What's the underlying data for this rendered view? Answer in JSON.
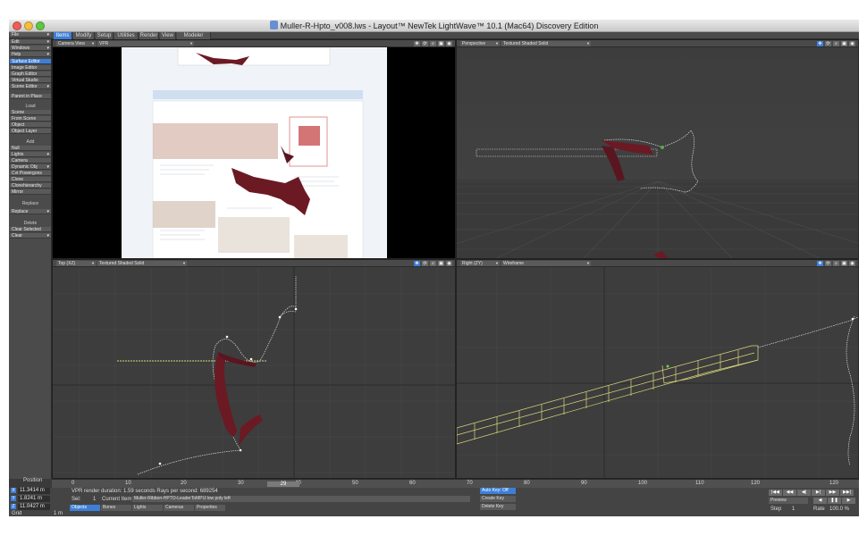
{
  "window": {
    "title": "Muller-R-Hpto_v008.lws - Layout™ NewTek LightWave™ 10.1 (Mac64) Discovery Edition",
    "colors": {
      "accent": "#3d7fd8",
      "close": "#ec5f58",
      "minimize": "#f5bd3a",
      "zoom": "#5fc73f",
      "ribbon": "#6b1a24",
      "spline": "#dddddd",
      "wire": "#d9d77a"
    }
  },
  "top_tabs": [
    "Items",
    "Modify",
    "Setup",
    "Utilities",
    "Render",
    "View",
    "Modeler Tools"
  ],
  "sidebar": {
    "menus": [
      "File",
      "Edit",
      "Windows",
      "Help"
    ],
    "tools": [
      "Surface Editor",
      "Image Editor",
      "Graph Editor",
      "Virtual Studio",
      "Scene Editor"
    ],
    "parent_in_place": "Parent in Place",
    "load_header": "Load",
    "load_items": [
      "Scene",
      "From Scene",
      "Object",
      "Object Layer"
    ],
    "add_header": "Add",
    "add_items": [
      "Null",
      "Lights",
      "Camera",
      "Dynamic Obj",
      "Cvt Powergons",
      "Clone",
      "Clonehierarchy",
      "Mirror"
    ],
    "replace_header": "Replace",
    "replace_items": [
      "Replace"
    ],
    "delete_header": "Delete",
    "delete_items": [
      "Clear Selected",
      "Clear"
    ]
  },
  "viewports": {
    "camera": {
      "view": "Camera View",
      "mode": "VPR"
    },
    "perspective": {
      "view": "Perspective",
      "mode": "Textured Shaded Solid"
    },
    "top": {
      "view": "Top",
      "axes": "(XZ)",
      "mode": "Textured Shaded Solid"
    },
    "right": {
      "view": "Right",
      "axes": "(ZY)",
      "mode": "Wireframe"
    }
  },
  "timeline": {
    "ticks": [
      "0",
      "10",
      "20",
      "30",
      "40",
      "50",
      "60",
      "70",
      "80",
      "90",
      "100",
      "110",
      "120"
    ],
    "end_label": "120",
    "current_frame": "29"
  },
  "position": {
    "label": "Position",
    "x": "11.3414 m",
    "y": "1.8241 m",
    "z": "11.0427 m",
    "grid_label": "Grid",
    "grid_value": "1 m"
  },
  "status": {
    "render_info": "VPR render duration: 1.59 seconds  Rays per second: 689254",
    "sel_label": "Sel:",
    "sel_count": "1",
    "current_item_label": "Current Item",
    "current_item": "Muller-Ribbon-HPTO-LeaderToMPU:low poly left"
  },
  "bottom_tabs": [
    "Objects",
    "Bones",
    "Lights",
    "Cameras",
    "Properties"
  ],
  "keys": {
    "auto_key": "Auto Key: Off",
    "create_key": "Create Key",
    "delete_key": "Delete Key"
  },
  "playback": {
    "buttons": [
      "|◀◀",
      "◀◀",
      "◀|",
      "▶|",
      "▶▶",
      "▶▶|"
    ],
    "preview": "Preview",
    "step": "Step",
    "step_value": "1",
    "rate_label": "Rate",
    "rate_value": "100.0 %"
  }
}
